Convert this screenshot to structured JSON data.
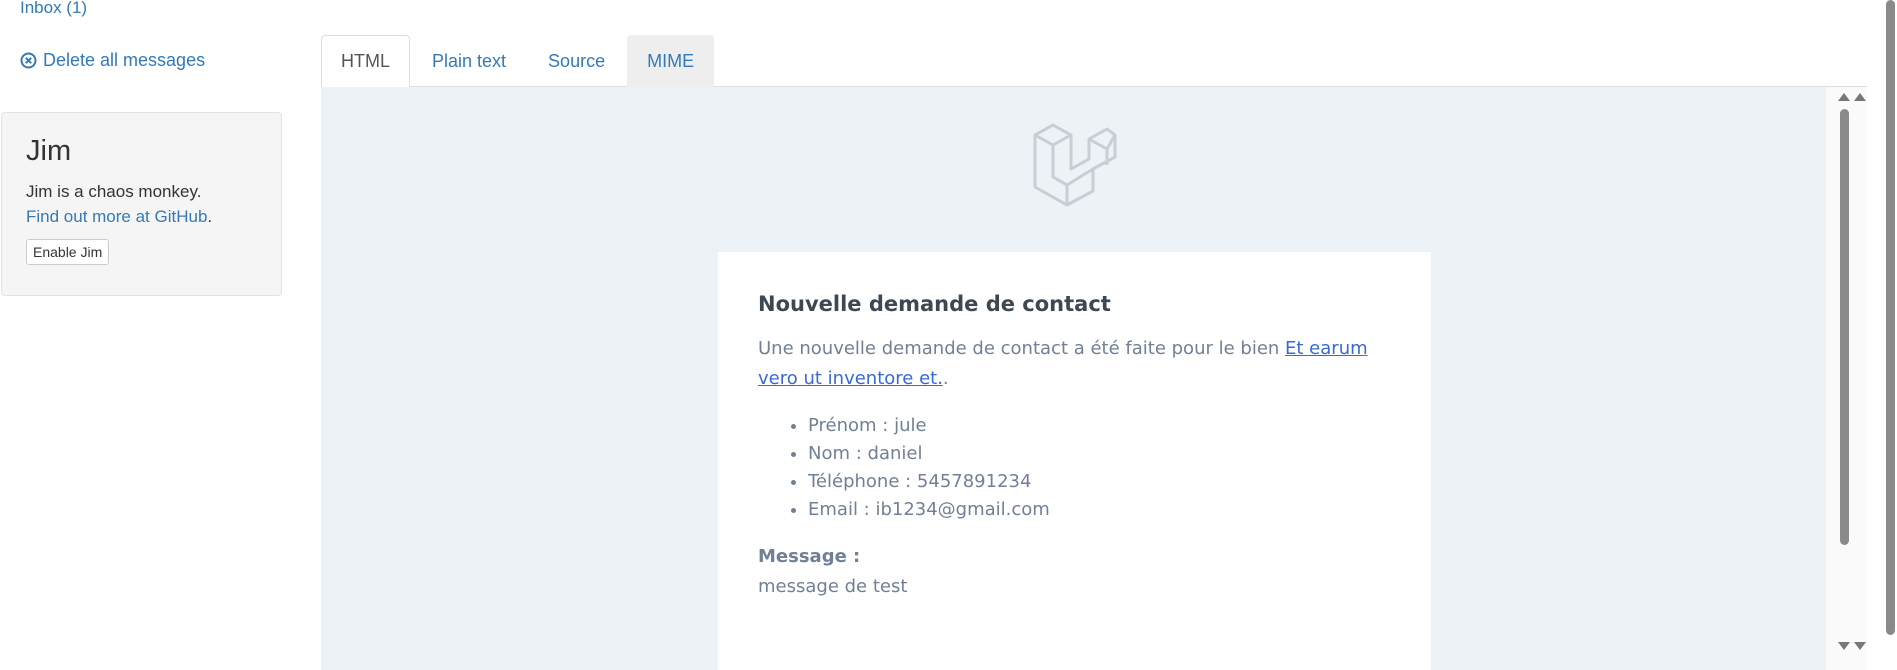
{
  "sidebar": {
    "inbox_label": "Inbox (1)",
    "delete_all_label": "Delete all messages",
    "jim": {
      "title": "Jim",
      "description": "Jim is a chaos monkey.",
      "link_text": "Find out more at GitHub",
      "link_suffix": ".",
      "button_label": "Enable Jim"
    }
  },
  "tabs": [
    {
      "label": "HTML",
      "state": "active"
    },
    {
      "label": "Plain text",
      "state": "normal"
    },
    {
      "label": "Source",
      "state": "normal"
    },
    {
      "label": "MIME",
      "state": "hover"
    }
  ],
  "email": {
    "logo_icon": "laravel-logo-icon",
    "title": "Nouvelle demande de contact",
    "intro_text": "Une nouvelle demande de contact a été faite pour le bien ",
    "property_link": "Et earum vero ut inventore et.",
    "intro_suffix": ".",
    "details": [
      "Prénom : jule",
      "Nom : daniel",
      "Téléphone : 5457891234",
      "Email : ib1234@gmail.com"
    ],
    "message_label": "Message :",
    "message_body": "message de test"
  },
  "colors": {
    "link": "#337ab7",
    "email_background": "#edf2f7",
    "email_text": "#718096",
    "email_heading": "#3d4852",
    "email_link": "#3869d4"
  }
}
